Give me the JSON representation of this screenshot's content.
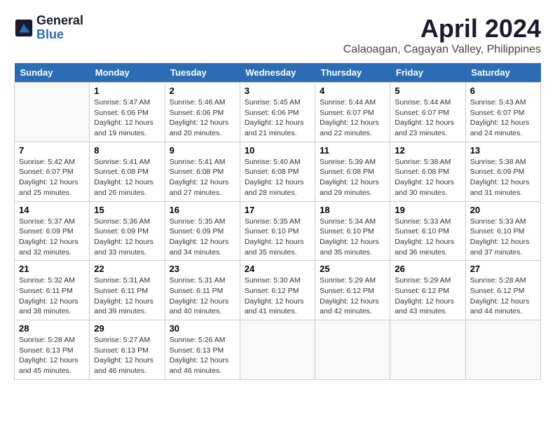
{
  "header": {
    "logo_general": "General",
    "logo_blue": "Blue",
    "month_title": "April 2024",
    "location": "Calaoagan, Cagayan Valley, Philippines"
  },
  "days_of_week": [
    "Sunday",
    "Monday",
    "Tuesday",
    "Wednesday",
    "Thursday",
    "Friday",
    "Saturday"
  ],
  "weeks": [
    [
      {
        "day": "",
        "info": ""
      },
      {
        "day": "1",
        "info": "Sunrise: 5:47 AM\nSunset: 6:06 PM\nDaylight: 12 hours\nand 19 minutes."
      },
      {
        "day": "2",
        "info": "Sunrise: 5:46 AM\nSunset: 6:06 PM\nDaylight: 12 hours\nand 20 minutes."
      },
      {
        "day": "3",
        "info": "Sunrise: 5:45 AM\nSunset: 6:06 PM\nDaylight: 12 hours\nand 21 minutes."
      },
      {
        "day": "4",
        "info": "Sunrise: 5:44 AM\nSunset: 6:07 PM\nDaylight: 12 hours\nand 22 minutes."
      },
      {
        "day": "5",
        "info": "Sunrise: 5:44 AM\nSunset: 6:07 PM\nDaylight: 12 hours\nand 23 minutes."
      },
      {
        "day": "6",
        "info": "Sunrise: 5:43 AM\nSunset: 6:07 PM\nDaylight: 12 hours\nand 24 minutes."
      }
    ],
    [
      {
        "day": "7",
        "info": "Sunrise: 5:42 AM\nSunset: 6:07 PM\nDaylight: 12 hours\nand 25 minutes."
      },
      {
        "day": "8",
        "info": "Sunrise: 5:41 AM\nSunset: 6:08 PM\nDaylight: 12 hours\nand 26 minutes."
      },
      {
        "day": "9",
        "info": "Sunrise: 5:41 AM\nSunset: 6:08 PM\nDaylight: 12 hours\nand 27 minutes."
      },
      {
        "day": "10",
        "info": "Sunrise: 5:40 AM\nSunset: 6:08 PM\nDaylight: 12 hours\nand 28 minutes."
      },
      {
        "day": "11",
        "info": "Sunrise: 5:39 AM\nSunset: 6:08 PM\nDaylight: 12 hours\nand 29 minutes."
      },
      {
        "day": "12",
        "info": "Sunrise: 5:38 AM\nSunset: 6:08 PM\nDaylight: 12 hours\nand 30 minutes."
      },
      {
        "day": "13",
        "info": "Sunrise: 5:38 AM\nSunset: 6:09 PM\nDaylight: 12 hours\nand 31 minutes."
      }
    ],
    [
      {
        "day": "14",
        "info": "Sunrise: 5:37 AM\nSunset: 6:09 PM\nDaylight: 12 hours\nand 32 minutes."
      },
      {
        "day": "15",
        "info": "Sunrise: 5:36 AM\nSunset: 6:09 PM\nDaylight: 12 hours\nand 33 minutes."
      },
      {
        "day": "16",
        "info": "Sunrise: 5:35 AM\nSunset: 6:09 PM\nDaylight: 12 hours\nand 34 minutes."
      },
      {
        "day": "17",
        "info": "Sunrise: 5:35 AM\nSunset: 6:10 PM\nDaylight: 12 hours\nand 35 minutes."
      },
      {
        "day": "18",
        "info": "Sunrise: 5:34 AM\nSunset: 6:10 PM\nDaylight: 12 hours\nand 35 minutes."
      },
      {
        "day": "19",
        "info": "Sunrise: 5:33 AM\nSunset: 6:10 PM\nDaylight: 12 hours\nand 36 minutes."
      },
      {
        "day": "20",
        "info": "Sunrise: 5:33 AM\nSunset: 6:10 PM\nDaylight: 12 hours\nand 37 minutes."
      }
    ],
    [
      {
        "day": "21",
        "info": "Sunrise: 5:32 AM\nSunset: 6:11 PM\nDaylight: 12 hours\nand 38 minutes."
      },
      {
        "day": "22",
        "info": "Sunrise: 5:31 AM\nSunset: 6:11 PM\nDaylight: 12 hours\nand 39 minutes."
      },
      {
        "day": "23",
        "info": "Sunrise: 5:31 AM\nSunset: 6:11 PM\nDaylight: 12 hours\nand 40 minutes."
      },
      {
        "day": "24",
        "info": "Sunrise: 5:30 AM\nSunset: 6:12 PM\nDaylight: 12 hours\nand 41 minutes."
      },
      {
        "day": "25",
        "info": "Sunrise: 5:29 AM\nSunset: 6:12 PM\nDaylight: 12 hours\nand 42 minutes."
      },
      {
        "day": "26",
        "info": "Sunrise: 5:29 AM\nSunset: 6:12 PM\nDaylight: 12 hours\nand 43 minutes."
      },
      {
        "day": "27",
        "info": "Sunrise: 5:28 AM\nSunset: 6:12 PM\nDaylight: 12 hours\nand 44 minutes."
      }
    ],
    [
      {
        "day": "28",
        "info": "Sunrise: 5:28 AM\nSunset: 6:13 PM\nDaylight: 12 hours\nand 45 minutes."
      },
      {
        "day": "29",
        "info": "Sunrise: 5:27 AM\nSunset: 6:13 PM\nDaylight: 12 hours\nand 46 minutes."
      },
      {
        "day": "30",
        "info": "Sunrise: 5:26 AM\nSunset: 6:13 PM\nDaylight: 12 hours\nand 46 minutes."
      },
      {
        "day": "",
        "info": ""
      },
      {
        "day": "",
        "info": ""
      },
      {
        "day": "",
        "info": ""
      },
      {
        "day": "",
        "info": ""
      }
    ]
  ]
}
